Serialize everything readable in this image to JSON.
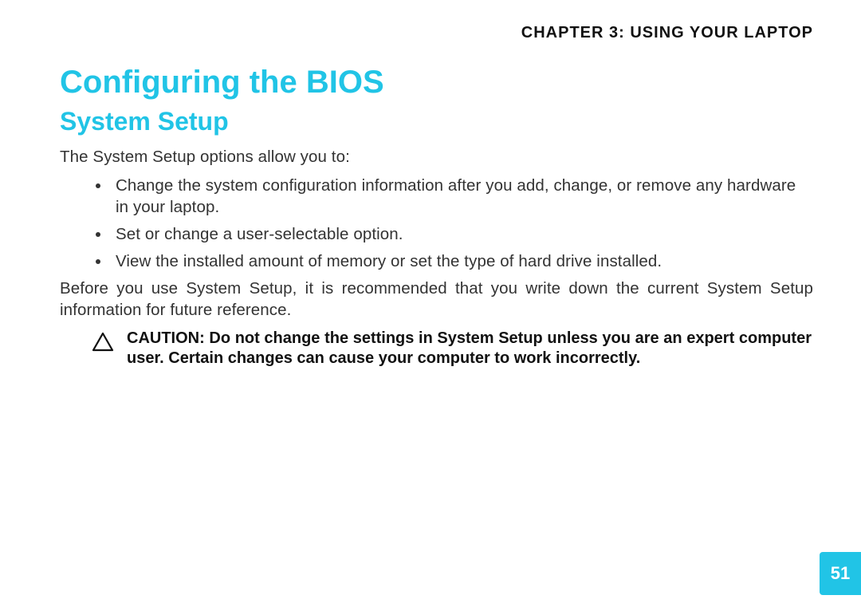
{
  "header": {
    "chapter_label": "CHAPTER 3: USING YOUR LAPTOP"
  },
  "headings": {
    "h1": "Configuring the BIOS",
    "h2": "System Setup"
  },
  "intro": "The System Setup options allow you to:",
  "bullets": [
    "Change the system configuration information after you add, change, or remove any hardware in your laptop.",
    "Set or change a user-selectable option.",
    "View the installed amount of memory or set the type of hard drive installed."
  ],
  "note": "Before you use System Setup, it is recommended that you write down the current System Setup information for future reference.",
  "caution": "CAUTION: Do not change the settings in System Setup unless you are an expert computer user. Certain changes can cause your computer to work incorrectly.",
  "page_number": "51"
}
